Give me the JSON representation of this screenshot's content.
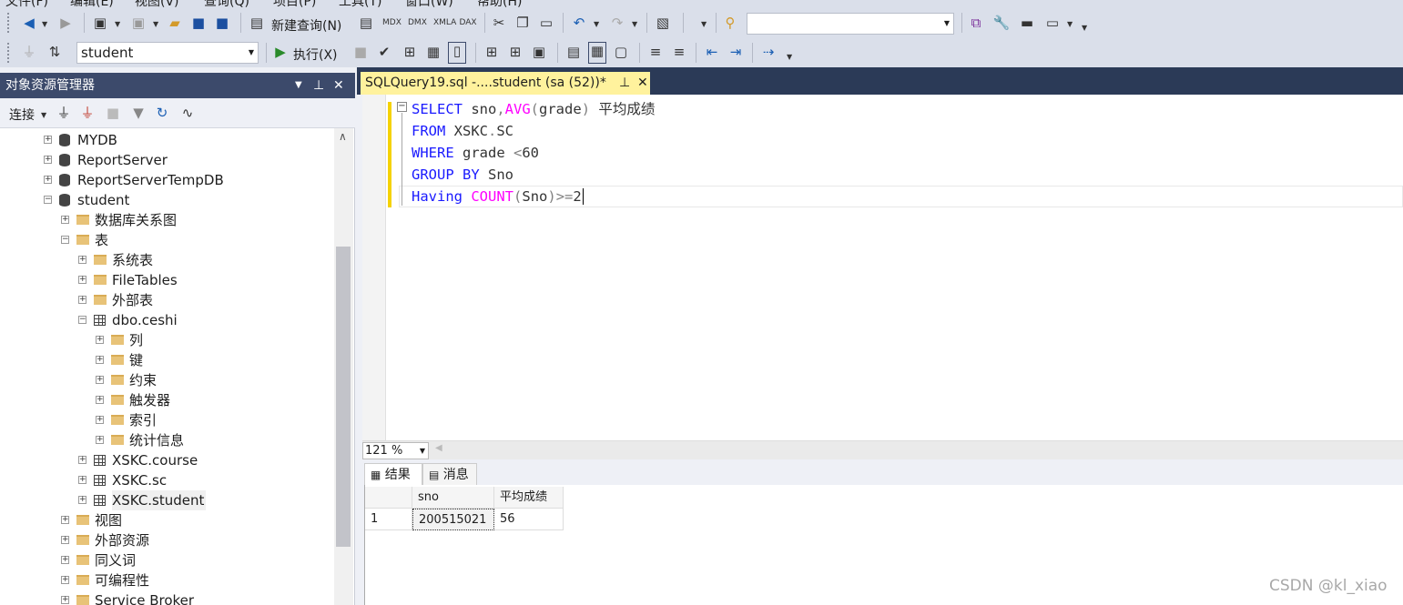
{
  "menu": {
    "items": [
      "文件(F)",
      "编辑(E)",
      "视图(V)",
      "查询(Q)",
      "项目(P)",
      "工具(T)",
      "窗口(W)",
      "帮助(H)"
    ]
  },
  "toolbar1": {
    "new_query": "新建查询(N)",
    "search_value": ""
  },
  "toolbar2": {
    "database": "student",
    "execute": "执行(X)"
  },
  "object_explorer": {
    "title": "对象资源管理器",
    "connect": "连接",
    "tree": [
      {
        "label": "MYDB",
        "type": "db",
        "level": 0,
        "state": "+"
      },
      {
        "label": "ReportServer",
        "type": "db",
        "level": 0,
        "state": "+"
      },
      {
        "label": "ReportServerTempDB",
        "type": "db",
        "level": 0,
        "state": "+"
      },
      {
        "label": "student",
        "type": "db",
        "level": 0,
        "state": "-"
      },
      {
        "label": "数据库关系图",
        "type": "folder",
        "level": 1,
        "state": "+"
      },
      {
        "label": "表",
        "type": "folder",
        "level": 1,
        "state": "-"
      },
      {
        "label": "系统表",
        "type": "folder",
        "level": 2,
        "state": "+"
      },
      {
        "label": "FileTables",
        "type": "folder",
        "level": 2,
        "state": "+"
      },
      {
        "label": "外部表",
        "type": "folder",
        "level": 2,
        "state": "+"
      },
      {
        "label": "dbo.ceshi",
        "type": "table",
        "level": 2,
        "state": "-"
      },
      {
        "label": "列",
        "type": "folder",
        "level": 3,
        "state": "+"
      },
      {
        "label": "键",
        "type": "folder",
        "level": 3,
        "state": "+"
      },
      {
        "label": "约束",
        "type": "folder",
        "level": 3,
        "state": "+"
      },
      {
        "label": "触发器",
        "type": "folder",
        "level": 3,
        "state": "+"
      },
      {
        "label": "索引",
        "type": "folder",
        "level": 3,
        "state": "+"
      },
      {
        "label": "统计信息",
        "type": "folder",
        "level": 3,
        "state": "+"
      },
      {
        "label": "XSKC.course",
        "type": "table",
        "level": 2,
        "state": "+"
      },
      {
        "label": "XSKC.sc",
        "type": "table",
        "level": 2,
        "state": "+"
      },
      {
        "label": "XSKC.student",
        "type": "table",
        "level": 2,
        "state": "+"
      },
      {
        "label": "视图",
        "type": "folder",
        "level": 1,
        "state": "+"
      },
      {
        "label": "外部资源",
        "type": "folder",
        "level": 1,
        "state": "+"
      },
      {
        "label": "同义词",
        "type": "folder",
        "level": 1,
        "state": "+"
      },
      {
        "label": "可编程性",
        "type": "folder",
        "level": 1,
        "state": "+"
      },
      {
        "label": "Service Broker",
        "type": "folder",
        "level": 1,
        "state": "+"
      }
    ]
  },
  "editor": {
    "tab_title": "SQLQuery19.sql -....student (sa (52))*",
    "lines": [
      [
        [
          "kw",
          "SELECT"
        ],
        [
          "tx",
          " sno"
        ],
        [
          "op",
          ","
        ],
        [
          "fn",
          "AVG"
        ],
        [
          "op",
          "("
        ],
        [
          "tx",
          "grade"
        ],
        [
          "op",
          ")"
        ],
        [
          "tx",
          " 平均成绩"
        ]
      ],
      [
        [
          "kw",
          "FROM"
        ],
        [
          "tx",
          " XSKC"
        ],
        [
          "op",
          "."
        ],
        [
          "tx",
          "SC"
        ]
      ],
      [
        [
          "kw",
          "WHERE"
        ],
        [
          "tx",
          " grade "
        ],
        [
          "op",
          "<"
        ],
        [
          "tx",
          "60"
        ]
      ],
      [
        [
          "kw",
          "GROUP"
        ],
        [
          "tx",
          " "
        ],
        [
          "kw",
          "BY"
        ],
        [
          "tx",
          " Sno"
        ]
      ],
      [
        [
          "kw",
          "Having"
        ],
        [
          "tx",
          " "
        ],
        [
          "fn",
          "COUNT"
        ],
        [
          "op",
          "("
        ],
        [
          "tx",
          "Sno"
        ],
        [
          "op",
          ")>="
        ],
        [
          "tx",
          "2"
        ]
      ]
    ]
  },
  "zoom": "121 %",
  "results": {
    "tabs": [
      "结果",
      "消息"
    ],
    "columns": [
      "sno",
      "平均成绩"
    ],
    "rows": [
      {
        "num": "1",
        "sno": "200515021",
        "avg": "56"
      }
    ]
  },
  "watermark": "CSDN @kl_xiao"
}
